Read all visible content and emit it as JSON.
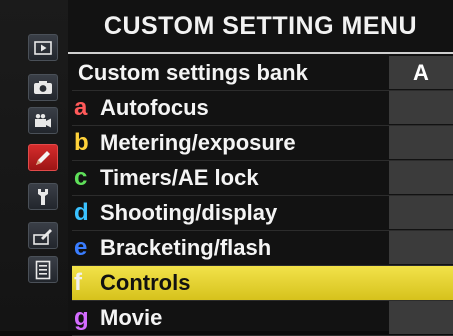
{
  "header": {
    "title": "CUSTOM SETTING MENU"
  },
  "sidebar": {
    "tabs": [
      {
        "icon": "playback-icon"
      },
      {
        "icon": "photo-shooting-icon"
      },
      {
        "icon": "movie-shooting-icon"
      },
      {
        "icon": "custom-setting-pencil-icon",
        "active": true
      },
      {
        "icon": "setup-wrench-icon"
      },
      {
        "icon": "retouch-brush-icon"
      },
      {
        "icon": "my-menu-icon"
      }
    ]
  },
  "menu": {
    "bank": {
      "label": "Custom settings bank",
      "value": "A"
    },
    "items": [
      {
        "letter": "a",
        "label": "Autofocus",
        "color": "#ff5a5a"
      },
      {
        "letter": "b",
        "label": "Metering/exposure",
        "color": "#ffd23a"
      },
      {
        "letter": "c",
        "label": "Timers/AE lock",
        "color": "#5fe05a"
      },
      {
        "letter": "d",
        "label": "Shooting/display",
        "color": "#3ac2ff"
      },
      {
        "letter": "e",
        "label": "Bracketing/flash",
        "color": "#3a7dff"
      },
      {
        "letter": "f",
        "label": "Controls",
        "color": "#f0f0f0",
        "selected": true
      },
      {
        "letter": "g",
        "label": "Movie",
        "color": "#d46cff"
      }
    ]
  },
  "colors": {
    "selection": "#e6d431",
    "active_tab": "#c82222"
  }
}
